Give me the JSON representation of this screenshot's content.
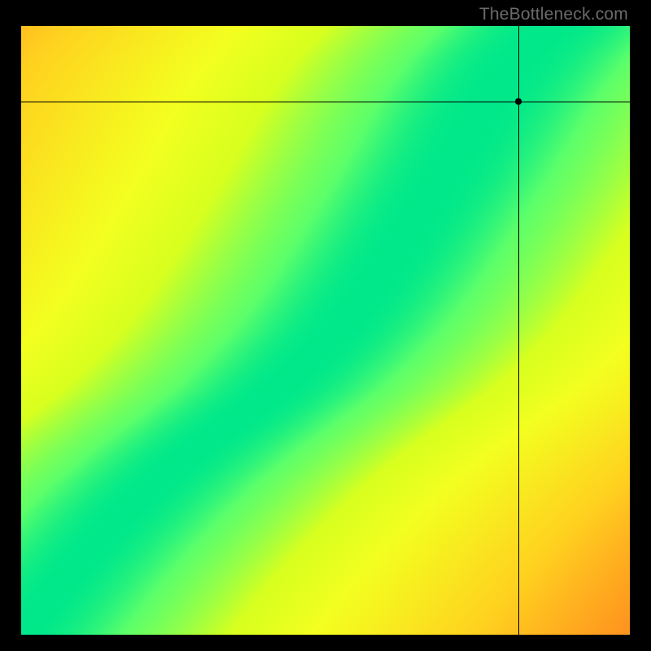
{
  "watermark_text": "TheBottleneck.com",
  "colors": {
    "background": "#000000",
    "watermark": "#6a6a6a",
    "crosshair": "#000000",
    "marker": "#000000"
  },
  "chart_data": {
    "type": "heatmap",
    "title": "",
    "xlabel": "",
    "ylabel": "",
    "xlim": [
      0,
      1
    ],
    "ylim": [
      0,
      1
    ],
    "crosshair": {
      "x": 0.818,
      "y": 0.876
    },
    "marker": {
      "x": 0.818,
      "y": 0.876,
      "r": 4
    },
    "ridge_x_at_y": [
      [
        0.0,
        0.0
      ],
      [
        0.05,
        0.038
      ],
      [
        0.1,
        0.078
      ],
      [
        0.15,
        0.122
      ],
      [
        0.2,
        0.17
      ],
      [
        0.25,
        0.222
      ],
      [
        0.3,
        0.282
      ],
      [
        0.35,
        0.35
      ],
      [
        0.4,
        0.418
      ],
      [
        0.45,
        0.472
      ],
      [
        0.5,
        0.52
      ],
      [
        0.55,
        0.56
      ],
      [
        0.6,
        0.595
      ],
      [
        0.65,
        0.628
      ],
      [
        0.7,
        0.66
      ],
      [
        0.75,
        0.692
      ],
      [
        0.8,
        0.722
      ],
      [
        0.85,
        0.75
      ],
      [
        0.9,
        0.782
      ],
      [
        0.95,
        0.82
      ],
      [
        1.0,
        0.87
      ]
    ],
    "palette_stops": [
      [
        0.0,
        "#ff1f3a"
      ],
      [
        0.28,
        "#ff7a1f"
      ],
      [
        0.55,
        "#ffd11f"
      ],
      [
        0.78,
        "#f3ff1f"
      ],
      [
        0.88,
        "#d7ff1f"
      ],
      [
        0.97,
        "#5cff6a"
      ],
      [
        1.0,
        "#00e88a"
      ]
    ],
    "legend": []
  }
}
